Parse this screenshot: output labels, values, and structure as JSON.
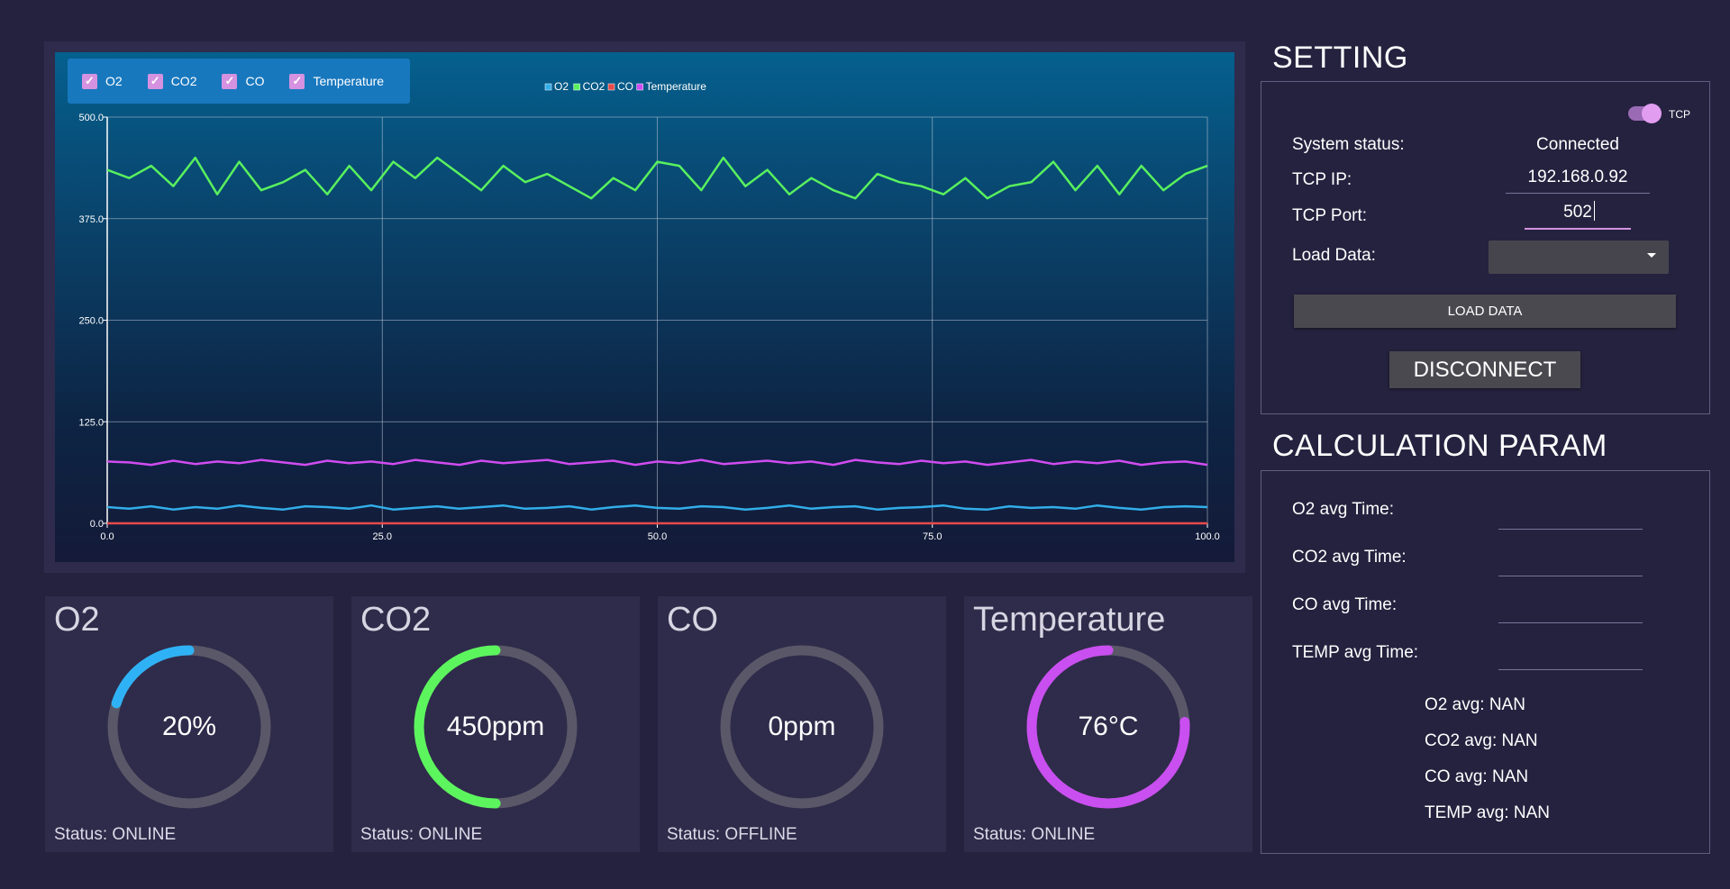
{
  "chart": {
    "toggles": [
      {
        "label": "O2",
        "checked": true
      },
      {
        "label": "CO2",
        "checked": true
      },
      {
        "label": "CO",
        "checked": true
      },
      {
        "label": "Temperature",
        "checked": true
      }
    ],
    "check_glyph": "check-icon"
  },
  "chart_data": {
    "type": "line",
    "title": "",
    "xlabel": "",
    "ylabel": "",
    "xlim": [
      0,
      100
    ],
    "ylim": [
      0,
      500
    ],
    "x_ticks": [
      "0.0",
      "25.0",
      "50.0",
      "75.0",
      "100.0"
    ],
    "y_ticks": [
      "0.0",
      "125.0",
      "250.0",
      "375.0",
      "500.0"
    ],
    "grid": true,
    "legend_position": "top-center",
    "x": [
      0,
      2,
      4,
      6,
      8,
      10,
      12,
      14,
      16,
      18,
      20,
      22,
      24,
      26,
      28,
      30,
      32,
      34,
      36,
      38,
      40,
      42,
      44,
      46,
      48,
      50,
      52,
      54,
      56,
      58,
      60,
      62,
      64,
      66,
      68,
      70,
      72,
      74,
      76,
      78,
      80,
      82,
      84,
      86,
      88,
      90,
      92,
      94,
      96,
      98,
      100
    ],
    "series": [
      {
        "name": "O2",
        "color": "#32aeea",
        "values": [
          20,
          18,
          21,
          17,
          20,
          18,
          22,
          19,
          17,
          21,
          20,
          18,
          22,
          17,
          19,
          21,
          18,
          20,
          22,
          18,
          19,
          21,
          17,
          20,
          22,
          19,
          18,
          21,
          20,
          17,
          19,
          22,
          18,
          20,
          21,
          17,
          19,
          20,
          22,
          18,
          17,
          21,
          19,
          20,
          18,
          22,
          19,
          17,
          20,
          21,
          20
        ]
      },
      {
        "name": "CO2",
        "color": "#59f05e",
        "values": [
          435,
          425,
          440,
          415,
          450,
          405,
          445,
          410,
          420,
          435,
          405,
          440,
          410,
          445,
          425,
          450,
          430,
          410,
          440,
          420,
          430,
          415,
          400,
          425,
          410,
          445,
          440,
          410,
          450,
          415,
          435,
          405,
          425,
          410,
          400,
          430,
          420,
          415,
          405,
          425,
          400,
          415,
          420,
          445,
          410,
          440,
          405,
          440,
          410,
          430,
          440
        ]
      },
      {
        "name": "CO",
        "color": "#e84a4a",
        "values": [
          0,
          0,
          0,
          0,
          0,
          0,
          0,
          0,
          0,
          0,
          0,
          0,
          0,
          0,
          0,
          0,
          0,
          0,
          0,
          0,
          0,
          0,
          0,
          0,
          0,
          0,
          0,
          0,
          0,
          0,
          0,
          0,
          0,
          0,
          0,
          0,
          0,
          0,
          0,
          0,
          0,
          0,
          0,
          0,
          0,
          0,
          0,
          0,
          0,
          0,
          0
        ]
      },
      {
        "name": "Temperature",
        "color": "#d04cf0",
        "values": [
          76,
          75,
          72,
          77,
          73,
          76,
          74,
          78,
          75,
          72,
          77,
          74,
          76,
          73,
          78,
          75,
          72,
          77,
          74,
          76,
          78,
          73,
          75,
          77,
          72,
          76,
          74,
          78,
          73,
          75,
          77,
          74,
          76,
          72,
          78,
          75,
          73,
          77,
          74,
          76,
          72,
          75,
          78,
          73,
          76,
          74,
          77,
          72,
          75,
          76,
          72
        ]
      }
    ]
  },
  "setting": {
    "title": "SETTING",
    "toggle_label": "TCP",
    "toggle_on": true,
    "status_label": "System status:",
    "status_value": "Connected",
    "ip_label": "TCP IP:",
    "ip_value": "192.168.0.92",
    "port_label": "TCP Port:",
    "port_value": "502",
    "load_label": "Load Data:",
    "load_value": "",
    "load_button": "LOAD DATA",
    "disconnect_button": "DISCONNECT"
  },
  "calc": {
    "title": "CALCULATION PARAM",
    "fields": [
      {
        "label": "O2 avg Time:",
        "value": ""
      },
      {
        "label": "CO2 avg Time:",
        "value": ""
      },
      {
        "label": "CO avg Time:",
        "value": ""
      },
      {
        "label": "TEMP avg Time:",
        "value": ""
      }
    ],
    "results": [
      "O2 avg: NAN",
      "CO2 avg: NAN",
      "CO avg: NAN",
      "TEMP avg: NAN"
    ]
  },
  "gauges": [
    {
      "title": "O2",
      "value": "20%",
      "status": "Status: ONLINE",
      "fraction": 0.2,
      "color": "#2fb2f5"
    },
    {
      "title": "CO2",
      "value": "450ppm",
      "status": "Status: ONLINE",
      "fraction": 0.5,
      "color": "#5cf55e"
    },
    {
      "title": "CO",
      "value": "0ppm",
      "status": "Status: OFFLINE",
      "fraction": 0,
      "color": "#d04cf0"
    },
    {
      "title": "Temperature",
      "value": "76°C",
      "status": "Status: ONLINE",
      "fraction": 0.76,
      "color": "#c94ff0"
    }
  ]
}
